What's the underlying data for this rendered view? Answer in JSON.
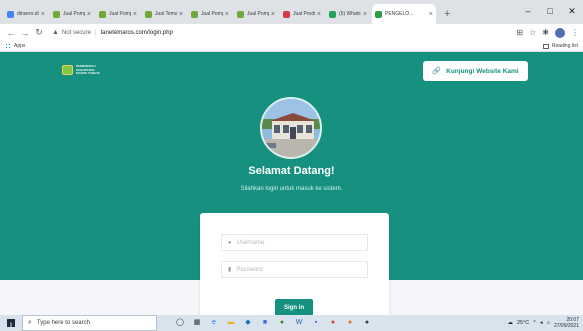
{
  "browser": {
    "tabs": [
      {
        "title": "dinsero.di",
        "color": "#4285f4"
      },
      {
        "title": "Jual Pomp",
        "color": "#6fa83a"
      },
      {
        "title": "Jual Pomp",
        "color": "#6fa83a"
      },
      {
        "title": "Jual Tema",
        "color": "#6fa83a"
      },
      {
        "title": "Jual Pomp",
        "color": "#6fa83a"
      },
      {
        "title": "Jual Pomp",
        "color": "#6fa83a"
      },
      {
        "title": "Jual Produ",
        "color": "#d93a4a"
      },
      {
        "title": "(5) Whats",
        "color": "#25a35a"
      },
      {
        "title": "PENGELO...",
        "color": "#2e9d44",
        "active": true
      }
    ],
    "new_tab_label": "+",
    "window_controls": {
      "minimize": "–",
      "maximize": "□",
      "close": "✕"
    },
    "address": {
      "security_label": "Not secure",
      "url": "tanetemaros.com/login.php"
    },
    "bookmarks": {
      "apps_label": "Apps",
      "reading_list_label": "Reading list"
    }
  },
  "page": {
    "brand": {
      "lines": [
        "PEMERINTAH",
        "KABUPATEN",
        "MAROS TANETE"
      ]
    },
    "visit_button": {
      "label": "Kunjungi Website Kami",
      "icon": "link-icon"
    },
    "welcome_title": "Selamat Datang!",
    "welcome_subtitle": "Silahkan login untuk masuk ke sistem.",
    "login": {
      "username_placeholder": "Username",
      "password_placeholder": "Password",
      "signin_label": "Sign in"
    },
    "colors": {
      "primary": "#16917f",
      "background": "#f4f6f9"
    }
  },
  "taskbar": {
    "search_placeholder": "Type here to search",
    "apps": [
      {
        "name": "task-view",
        "glyph": "◯",
        "color": "#1f2a37"
      },
      {
        "name": "store",
        "glyph": "▦",
        "color": "#1f2a37"
      },
      {
        "name": "edge",
        "glyph": "e",
        "color": "#1e7ad6"
      },
      {
        "name": "explorer",
        "glyph": "▬",
        "color": "#e8b22c"
      },
      {
        "name": "vscode",
        "glyph": "◆",
        "color": "#1e6fbf"
      },
      {
        "name": "app-blue",
        "glyph": "■",
        "color": "#2a6fd6"
      },
      {
        "name": "chrome",
        "glyph": "●",
        "color": "#3b8a3a"
      },
      {
        "name": "word",
        "glyph": "W",
        "color": "#2b5cb8"
      },
      {
        "name": "app-cam",
        "glyph": "▪",
        "color": "#3a62c8"
      },
      {
        "name": "chrome-2",
        "glyph": "●",
        "color": "#d9412f"
      },
      {
        "name": "firefox",
        "glyph": "●",
        "color": "#e86a1f"
      },
      {
        "name": "app-dark",
        "glyph": "●",
        "color": "#3b3f46"
      }
    ],
    "weather": "25°C",
    "time": "20:07",
    "date": "27/09/2021"
  }
}
